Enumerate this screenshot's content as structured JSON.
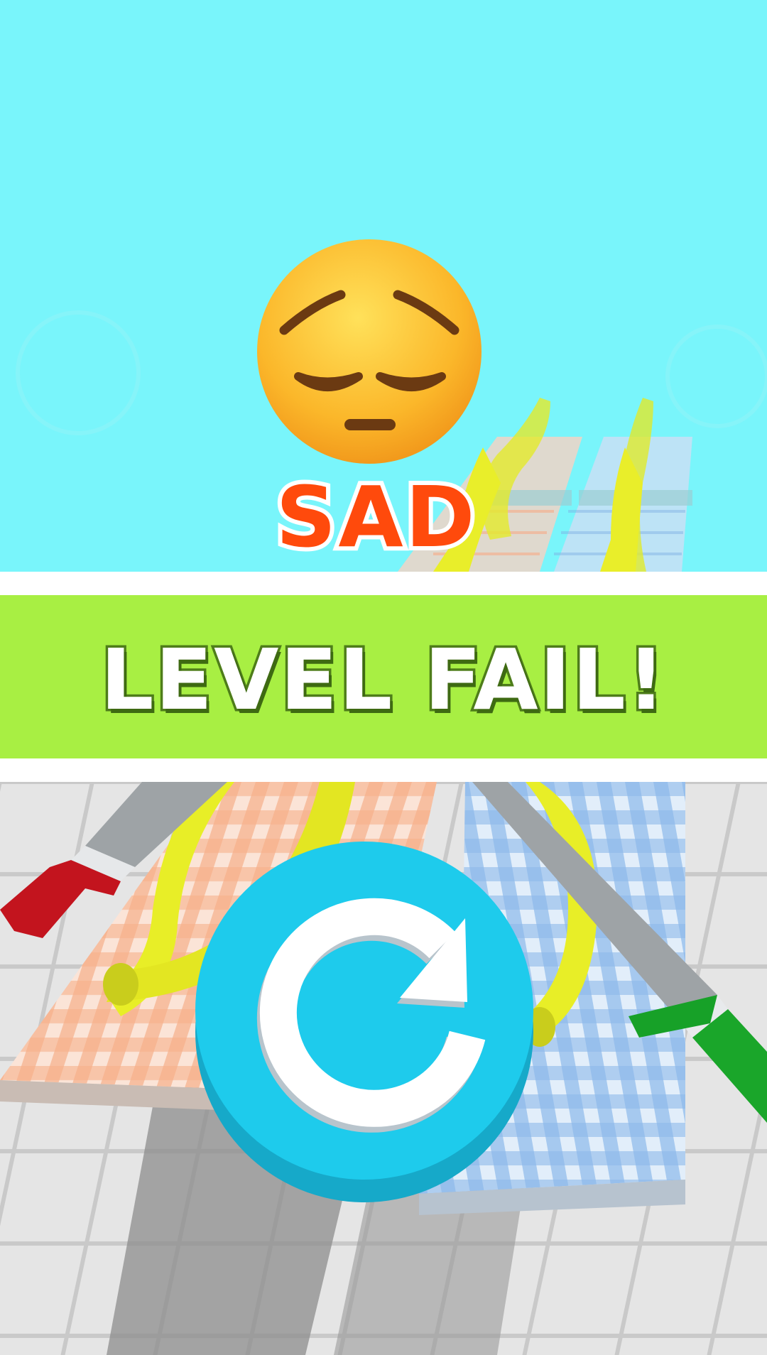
{
  "status": {
    "reaction_label": "SAD",
    "banner_label": "LEVEL FAIL!"
  },
  "icons": {
    "emoji": "pensive-face-icon",
    "retry": "restart-arrow-icon"
  },
  "colors": {
    "sky": "#79f5fb",
    "banner_green": "#a8ef43",
    "sad_text": "#ff4a0c",
    "retry_button": "#1ecbec",
    "retry_button_shadow": "#16a9c9"
  }
}
